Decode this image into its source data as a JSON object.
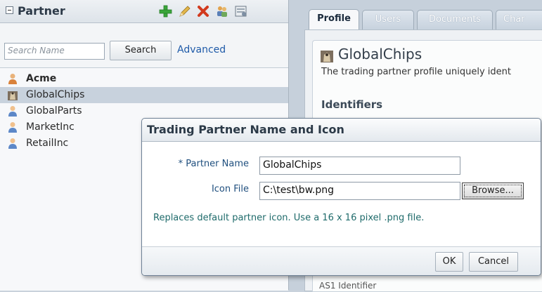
{
  "left_panel": {
    "title": "Partner",
    "toolbar": {
      "add_icon": "plus-icon",
      "edit_icon": "pencil-icon",
      "delete_icon": "delete-x-icon",
      "users_icon": "users-icon",
      "export_icon": "export-icon"
    },
    "search": {
      "placeholder": "Search Name",
      "button_label": "Search",
      "advanced_label": "Advanced"
    },
    "partners": [
      {
        "name": "Acme",
        "icon": "person-icon",
        "bold": true,
        "selected": false
      },
      {
        "name": "GlobalChips",
        "icon": "chip-icon",
        "bold": false,
        "selected": true
      },
      {
        "name": "GlobalParts",
        "icon": "person-icon",
        "bold": false,
        "selected": false
      },
      {
        "name": "MarketInc",
        "icon": "person-icon",
        "bold": false,
        "selected": false
      },
      {
        "name": "RetailInc",
        "icon": "person-icon",
        "bold": false,
        "selected": false
      }
    ]
  },
  "right_panel": {
    "tabs": [
      {
        "label": "Profile",
        "active": true
      },
      {
        "label": "Users",
        "active": false
      },
      {
        "label": "Documents",
        "active": false
      },
      {
        "label": "Char",
        "active": false
      }
    ],
    "profile_name": "GlobalChips",
    "profile_description": "The trading partner profile uniquely ident",
    "identifiers_heading": "Identifiers",
    "bottom_partial": "AS1 Identifier"
  },
  "dialog": {
    "title": "Trading Partner Name and Icon",
    "partner_name_label": "Partner Name",
    "required_marker": "*",
    "partner_name_value": "GlobalChips",
    "icon_file_label": "Icon File",
    "icon_file_value": "C:\\test\\bw.png",
    "browse_label": "Browse...",
    "help_text": "Replaces default partner icon. Use a 16 x 16 pixel .png file.",
    "ok_label": "OK",
    "cancel_label": "Cancel"
  },
  "colors": {
    "accent_link": "#1e5aa8",
    "add_green": "#3aa53a",
    "delete_red": "#d23a1e",
    "person_orange": "#d9823b"
  }
}
